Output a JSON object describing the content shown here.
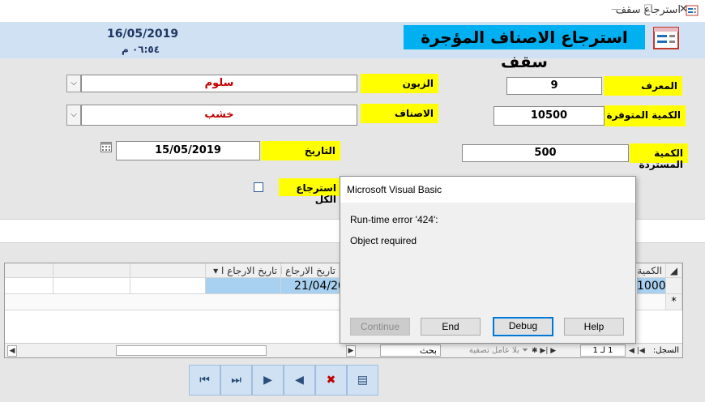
{
  "window": {
    "title": "استرجاع سقف",
    "min": "—",
    "max": "☐",
    "close": "✕"
  },
  "header": {
    "form_title": "استرجاع الاصناف المؤجرة سقف",
    "date": "16/05/2019",
    "time": "٠٦:٥٤ م"
  },
  "form": {
    "id_label": "المعرف",
    "id_value": "9",
    "available_label": "الكمية المتوفرة",
    "available_value": "10500",
    "returned_label": "الكمية المستردة",
    "returned_value": "500",
    "customer_label": "الزبون",
    "customer_value": "سلوم",
    "items_label": "الاصناف",
    "items_value": "خشب",
    "date_label": "التاريخ",
    "date_value": "15/05/2019",
    "return_all_label": "استرجاع الكل"
  },
  "grid": {
    "headers": [
      "الكمية",
      "تاريخ الارجاع ا",
      "تاريخ الارجاع ا"
    ],
    "row": {
      "qty": "1000",
      "date": "21/04/20"
    },
    "new_row_marker": "*",
    "record_label": "السجل:",
    "record_value": "1 لـ 1",
    "filter_label": "بلا عامل تصفية",
    "search_label": "بحث"
  },
  "dialog": {
    "title": "Microsoft Visual Basic",
    "error": "Run-time error '424':",
    "message": "Object required",
    "buttons": {
      "continue": "Continue",
      "end": "End",
      "debug": "Debug",
      "help": "Help"
    }
  },
  "nav": {
    "first": "⏮",
    "next_last": "⏭",
    "next": "▶",
    "prev": "◀",
    "delete": "✖",
    "new": "▤"
  },
  "icons": {
    "calendar": "calendar-icon",
    "app": "form-icon"
  }
}
